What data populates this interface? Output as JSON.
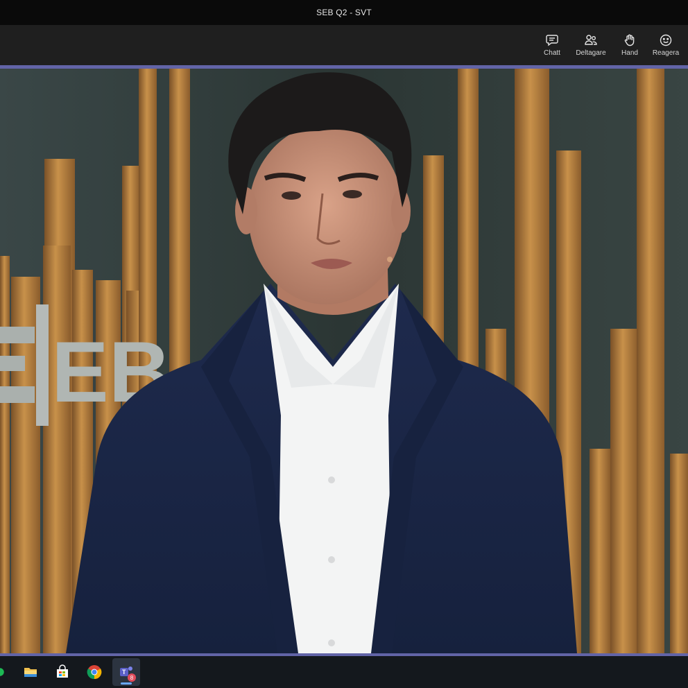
{
  "window": {
    "title": "SEB Q2 - SVT"
  },
  "toolbar": {
    "actions": [
      {
        "label": "Chatt",
        "icon": "chat-icon"
      },
      {
        "label": "Deltagare",
        "icon": "participants-icon"
      },
      {
        "label": "Hand",
        "icon": "raise-hand-icon"
      },
      {
        "label": "Reagera",
        "icon": "react-icon"
      }
    ]
  },
  "stage": {
    "backdrop_logo_text": "EB"
  },
  "taskbar": {
    "apps": [
      {
        "icon": "spotify-icon"
      },
      {
        "icon": "file-explorer-icon"
      },
      {
        "icon": "microsoft-store-icon"
      },
      {
        "icon": "chrome-icon"
      },
      {
        "icon": "teams-icon",
        "badge": "8"
      }
    ]
  },
  "colors": {
    "accent": "#6264a7",
    "toolbar_bg": "#1f1f1f",
    "taskbar_bg": "#14181d"
  }
}
